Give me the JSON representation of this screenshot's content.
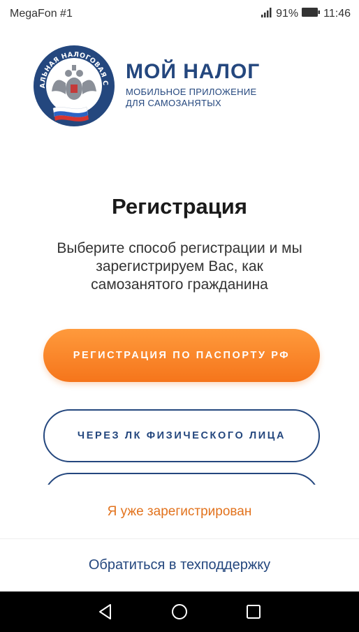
{
  "status_bar": {
    "carrier": "MegaFon #1",
    "battery_percent": "91%",
    "time": "11:46"
  },
  "logo": {
    "emblem_text": "ФЕДЕРАЛЬНАЯ НАЛОГОВАЯ СЛУЖБА",
    "title": "МОЙ НАЛОГ",
    "subtitle_line1": "МОБИЛЬНОЕ ПРИЛОЖЕНИЕ",
    "subtitle_line2": "ДЛЯ САМОЗАНЯТЫХ"
  },
  "main": {
    "title": "Регистрация",
    "description": "Выберите способ регистрации и мы зарегистрируем Вас, как самозанятого гражданина",
    "buttons": [
      {
        "label": "РЕГИСТРАЦИЯ ПО ПАСПОРТУ РФ"
      },
      {
        "label": "ЧЕРЕЗ ЛК ФИЗИЧЕСКОГО ЛИЦА"
      }
    ],
    "already_registered": "Я уже зарегистрирован",
    "support": "Обратиться в техподдержку"
  },
  "colors": {
    "brand_blue": "#24477e",
    "accent_orange": "#f5751b",
    "link_orange": "#e2731e"
  },
  "icons": {
    "nav": [
      "back-triangle-icon",
      "home-circle-icon",
      "recents-square-icon"
    ]
  }
}
